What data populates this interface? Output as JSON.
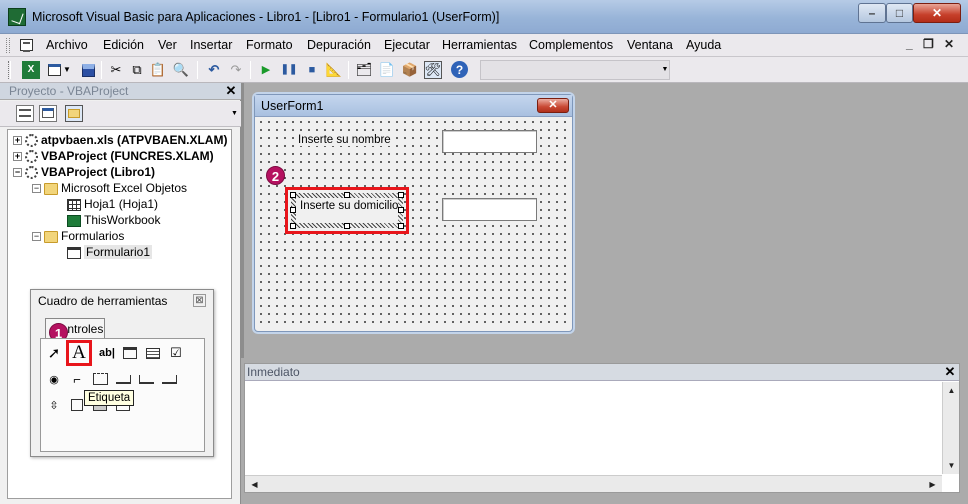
{
  "window": {
    "title": "Microsoft Visual Basic para Aplicaciones - Libro1 - [Libro1 - Formulario1 (UserForm)]",
    "minimize": "–",
    "maximize": "□",
    "close": "✕"
  },
  "menu": {
    "items": [
      "Archivo",
      "Edición",
      "Ver",
      "Insertar",
      "Formato",
      "Depuración",
      "Ejecutar",
      "Herramientas",
      "Complementos",
      "Ventana",
      "Ayuda"
    ],
    "mdi_minimize": "_",
    "mdi_restore": "❐",
    "mdi_close": "✕"
  },
  "toolbar": {
    "icons": [
      "excel-icon",
      "insert-userform-icon",
      "save-icon",
      "cut-icon",
      "copy-icon",
      "paste-icon",
      "find-icon",
      "undo-icon",
      "redo-icon",
      "run-icon",
      "break-icon",
      "reset-icon",
      "design-mode-icon",
      "project-explorer-icon",
      "properties-icon",
      "object-browser-icon",
      "toolbox-icon",
      "help-icon"
    ]
  },
  "project": {
    "title": "Proyecto - VBAProject",
    "close": "✕",
    "tree": [
      {
        "label": "atpvbaen.xls (ATPVBAEN.XLAM)",
        "bold": true,
        "expander": "+",
        "icon": "gear"
      },
      {
        "label": "VBAProject (FUNCRES.XLAM)",
        "bold": true,
        "expander": "+",
        "icon": "gear"
      },
      {
        "label": "VBAProject (Libro1)",
        "bold": true,
        "expander": "−",
        "icon": "gear"
      },
      {
        "label": "Microsoft Excel Objetos",
        "expander": "−",
        "icon": "folder"
      },
      {
        "label": "Hoja1 (Hoja1)",
        "icon": "sheet"
      },
      {
        "label": "ThisWorkbook",
        "icon": "workbook"
      },
      {
        "label": "Formularios",
        "expander": "−",
        "icon": "folder"
      },
      {
        "label": "Formulario1",
        "icon": "form"
      }
    ]
  },
  "toolbox": {
    "title": "Cuadro de herramientas",
    "close": "⊠",
    "tab": "Controles",
    "tooltip": "Etiqueta",
    "callout1": "1"
  },
  "userform": {
    "title": "UserForm1",
    "close": "✕",
    "label1": "Inserte su nombre",
    "label2": "Inserte su domicilio",
    "callout2": "2"
  },
  "immediate": {
    "title": "Inmediato",
    "close": "✕"
  }
}
